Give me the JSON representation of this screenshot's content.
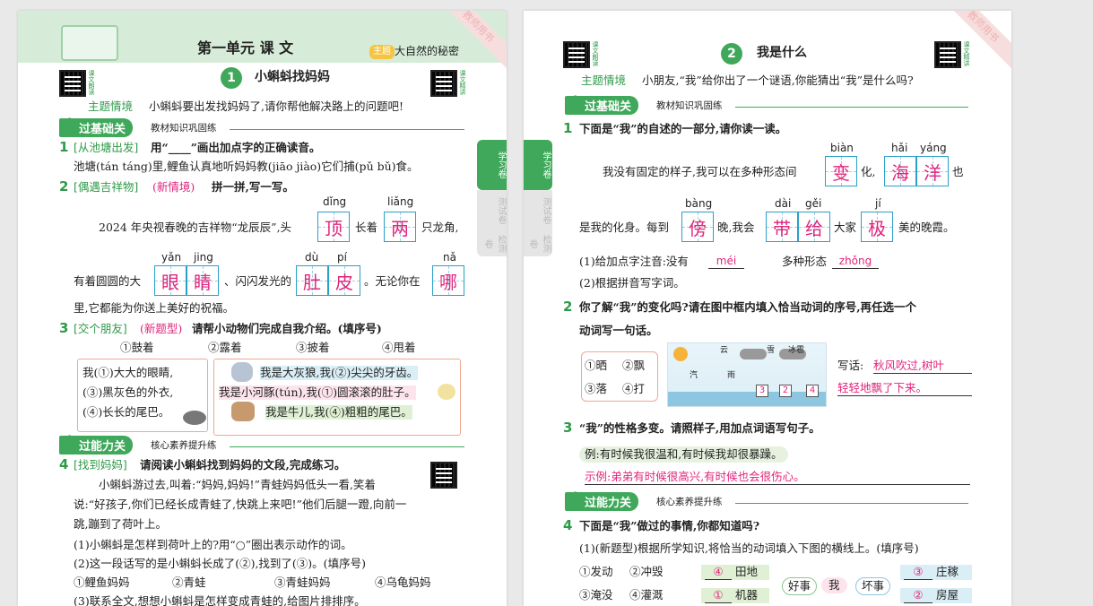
{
  "left": {
    "corner": "教师用书",
    "unit_title": "第一单元 课 文",
    "theme_tag": "主题",
    "theme_text": "大自然的秘密",
    "lesson_no": "1",
    "lesson_title": "小蝌蚪找妈妈",
    "qr_left_label": "课文朗读",
    "qr_right_label": "课文精讲",
    "scene_label": "主题情境",
    "scene_text": "小蝌蚪要出发找妈妈了,请你帮他解决路上的问题吧!",
    "sec1_label": "过基础关",
    "sec1_sub": "教材知识巩固练",
    "q1_no": "1",
    "q1_tag": "[从池塘出发]",
    "q1_text": "用“____”画出加点字的正确读音。",
    "q1_line": "池塘(tán táng)里,鲤鱼认真地听妈妈教(jiāo jiào)它们捕(pǔ bǔ)食。",
    "q2_no": "2",
    "q2_tag": "[偶遇吉祥物]",
    "q2_new": "(新情境)",
    "q2_text": "拼一拼,写一写。",
    "q2_l1a": "2024 年央视春晚的吉祥物“龙辰辰”,头",
    "q2_l1b": "长着",
    "q2_l1c": "只龙角,",
    "q2_py1": "dǐng",
    "q2_c1": "顶",
    "q2_py2": "liǎng",
    "q2_c2": "两",
    "q2_l2a": "有着圆圆的大",
    "q2_l2b": "、闪闪发光的",
    "q2_l2c": "。无论你在",
    "q2_py3": "yǎn",
    "q2_py4": "jing",
    "q2_c3": "眼",
    "q2_c4": "睛",
    "q2_py5": "dù",
    "q2_py6": "pí",
    "q2_c5": "肚",
    "q2_c6": "皮",
    "q2_py7": "nǎ",
    "q2_c7": "哪",
    "q2_l3": "里,它都能为你送上美好的祝福。",
    "q3_no": "3",
    "q3_tag": "[交个朋友]",
    "q3_new": "(新题型)",
    "q3_text": "请帮小动物们完成自我介绍。(填序号)",
    "q3_opts": [
      "①鼓着",
      "②露着",
      "③披着",
      "④甩着"
    ],
    "q3_a1": "我(①)大大的眼睛,",
    "q3_a2": "(③)黑灰色的外衣,",
    "q3_a3": "(④)长长的尾巴。",
    "q3_b1": "我是大灰狼,我(②)尖尖的牙齿。",
    "q3_b2": "我是小河豚(tún),我(①)圆滚滚的肚子。",
    "q3_b3": "我是牛儿,我(④)粗粗的尾巴。",
    "sec2_label": "过能力关",
    "sec2_sub": "核心素养提升练",
    "q4_no": "4",
    "q4_tag": "[找到妈妈]",
    "q4_text": "请阅读小蝌蚪找到妈妈的文段,完成练习。",
    "q4_p1": "小蝌蚪游过去,叫着:“妈妈,妈妈!”青蛙妈妈低头一看,笑着",
    "q4_p2": "说:“好孩子,你们已经长成青蛙了,快跳上来吧!”他们后腿一蹬,向前一",
    "q4_p3": "跳,蹦到了荷叶上。",
    "q4_s1": "(1)小蝌蚪是怎样到荷叶上的?用“○”圈出表示动作的词。",
    "q4_s2": "(2)这一段话写的是小蝌蚪长成了(②),找到了(③)。(填序号)",
    "q4_s2opts": [
      "①鲤鱼妈妈",
      "②青蛙",
      "③青蛙妈妈",
      "④乌龟妈妈"
    ],
    "q4_s3": "(3)联系全文,想想小蝌蚪是怎样变成青蛙的,给图片排排序。",
    "side_tabs": [
      "学习卷",
      "测试卷",
      "检测卷"
    ]
  },
  "right": {
    "corner": "教师用书",
    "lesson_no": "2",
    "lesson_title": "我是什么",
    "qr_left_label": "课文朗读",
    "qr_right_label": "课文精讲",
    "scene_label": "主题情境",
    "scene_text": "小朋友,“我”给你出了一个谜语,你能猜出“我”是什么吗?",
    "sec1_label": "过基础关",
    "sec1_sub": "教材知识巩固练",
    "q1_no": "1",
    "q1_text": "下面是“我”的自述的一部分,请你读一读。",
    "q1_l1a": "我没有固定的样子,我可以在多种形态间",
    "q1_l1b": "化,",
    "q1_l1c": "也",
    "q1_py1": "biàn",
    "q1_c1": "变",
    "q1_py2": "hǎi",
    "q1_py3": "yáng",
    "q1_c2": "海",
    "q1_c3": "洋",
    "q1_l2a": "是我的化身。每到",
    "q1_l2b": "晚,我会",
    "q1_l2c": "大家",
    "q1_l2d": "美的晚霞。",
    "q1_py4": "bàng",
    "q1_c4": "傍",
    "q1_py5": "dài",
    "q1_py6": "gěi",
    "q1_c5": "带",
    "q1_c6": "给",
    "q1_py7": "jí",
    "q1_c7": "极",
    "q1_s1a": "(1)给加点字注音:没有",
    "q1_s1ans1": "méi",
    "q1_s1b": "多种形态",
    "q1_s1ans2": "zhǒng",
    "q1_s2": "(2)根据拼音写字词。",
    "q2_no": "2",
    "q2_text1": "你了解“我”的变化吗?请在图中框内填入恰当动词的序号,再任选一个",
    "q2_text2": "动词写一句话。",
    "q2_opts": [
      "①晒",
      "②飘",
      "③落",
      "④打"
    ],
    "q2_img_labels": [
      "云",
      "雪",
      "冰雹",
      "汽",
      "雨"
    ],
    "q2_box_ans": [
      "3",
      "2",
      "4"
    ],
    "q2_write_label": "写话:",
    "q2_write_ans1": "秋风吹过,树叶",
    "q2_write_ans2": "轻轻地飘了下来。",
    "q3_no": "3",
    "q3_text": "“我”的性格多变。请照样子,用加点词语写句子。",
    "q3_example": "例:有时候我很温和,有时候我却很暴躁。",
    "q3_answer": "示例:弟弟有时候很高兴,有时候也会很伤心。",
    "sec2_label": "过能力关",
    "sec2_sub": "核心素养提升练",
    "q4_no": "4",
    "q4_text": "下面是“我”做过的事情,你都知道吗?",
    "q4_s1": "(1)(新题型)根据所学知识,将恰当的动词填入下图的横线上。(填序号)",
    "q4_opts": [
      "①发动",
      "②冲毁",
      "③淹没",
      "④灌溉"
    ],
    "q4_left_items": [
      {
        "ans": "④",
        "word": "田地"
      },
      {
        "ans": "①",
        "word": "机器"
      }
    ],
    "q4_center": [
      "好事",
      "我",
      "坏事"
    ],
    "q4_right_items": [
      {
        "ans": "③",
        "word": "庄稼"
      },
      {
        "ans": "②",
        "word": "房屋"
      }
    ],
    "side_tabs": [
      "学习卷",
      "测试卷",
      "检测卷"
    ]
  }
}
